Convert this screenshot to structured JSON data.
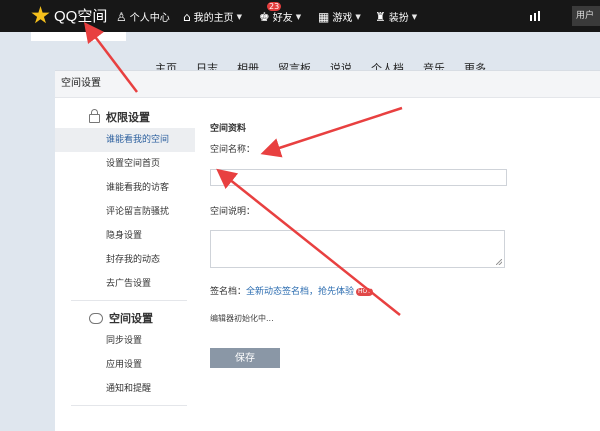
{
  "topbar": {
    "logo_text": "QQ空间",
    "nav": [
      {
        "label": "个人中心",
        "icon": "person-icon",
        "has_caret": false
      },
      {
        "label": "我的主页",
        "icon": "home-icon",
        "has_caret": true
      },
      {
        "label": "好友",
        "icon": "friends-icon",
        "has_caret": true,
        "badge": "23"
      },
      {
        "label": "游戏",
        "icon": "grid-icon",
        "has_caret": true
      },
      {
        "label": "装扮",
        "icon": "shirt-icon",
        "has_caret": true
      }
    ],
    "user_label": "用户"
  },
  "subnav": [
    "主页",
    "日志",
    "相册",
    "留言板",
    "说说",
    "个人档",
    "音乐",
    "更多"
  ],
  "panel_title": "空间设置",
  "sidebar": {
    "groups": [
      {
        "title": "权限设置",
        "icon": "lock-icon",
        "items": [
          "谁能看我的空间",
          "设置空间首页",
          "谁能看我的访客",
          "评论留言防骚扰",
          "隐身设置",
          "封存我的动态",
          "去广告设置"
        ]
      },
      {
        "title": "空间设置",
        "icon": "cloud-icon",
        "items": [
          "同步设置",
          "应用设置",
          "通知和提醒"
        ]
      }
    ],
    "selected_item": "谁能看我的空间"
  },
  "form": {
    "section_title": "空间资料",
    "name_label": "空间名称：",
    "name_value": "",
    "desc_label": "空间说明：",
    "desc_value": "",
    "signature_label": "签名档：",
    "signature_link": "全新动态签名档，抢先体验",
    "hot_badge": "HOT",
    "editor_status": "编辑器初始化中...",
    "save_label": "保存"
  },
  "annotation_color": "#e84040"
}
